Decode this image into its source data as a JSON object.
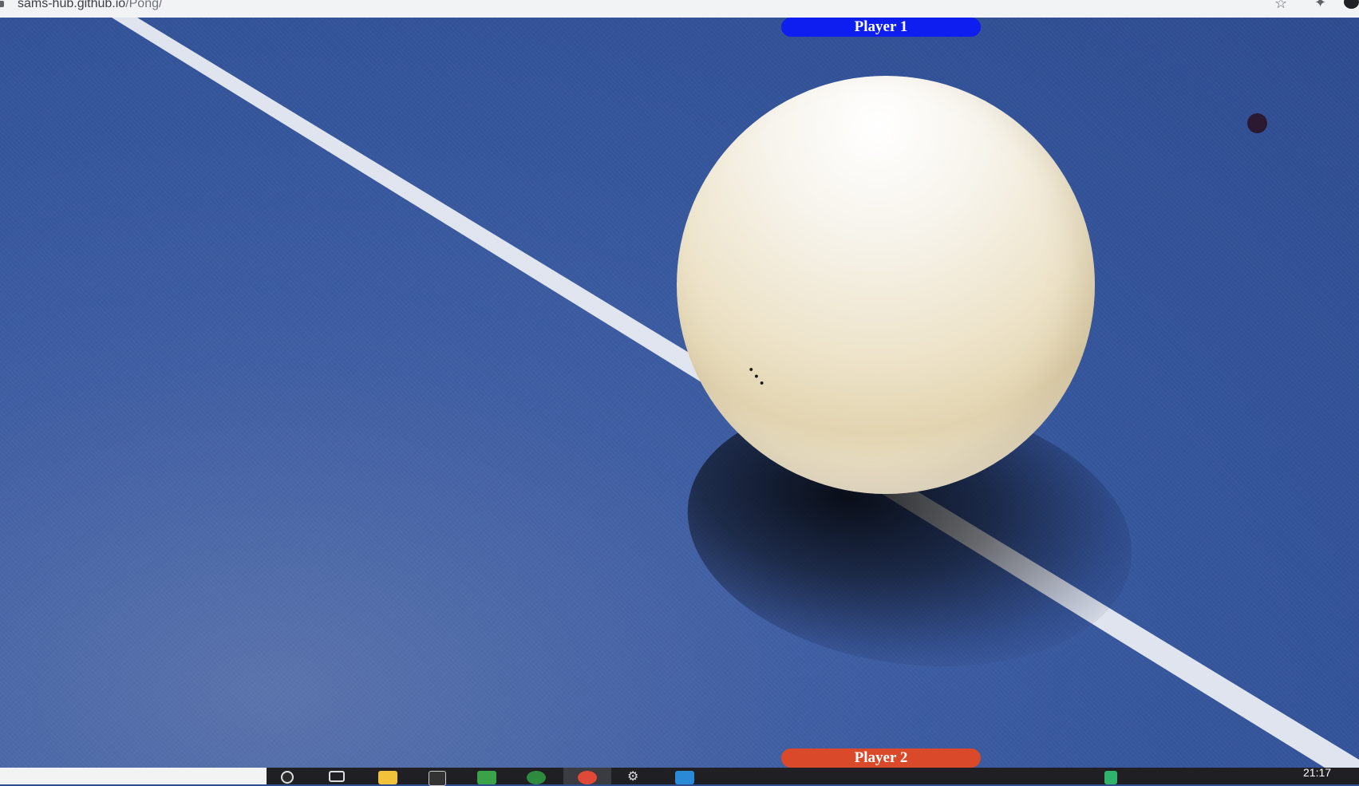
{
  "browser": {
    "url_host": "sams-hub.github.io",
    "url_path": "/Pong/"
  },
  "game": {
    "player1_label": "Player 1",
    "player2_label": "Player 2",
    "colors": {
      "player1": "#0f1ef0",
      "player2": "#d9492a",
      "table": "#36569c",
      "ball_dot": "#2a1930"
    }
  },
  "taskbar": {
    "clock": "21:17",
    "icons": [
      "search-icon",
      "task-view-icon",
      "file-explorer-icon",
      "epic-games-icon",
      "app-icon",
      "chrome-alt-icon",
      "chrome-icon",
      "settings-icon",
      "vscode-icon"
    ]
  }
}
